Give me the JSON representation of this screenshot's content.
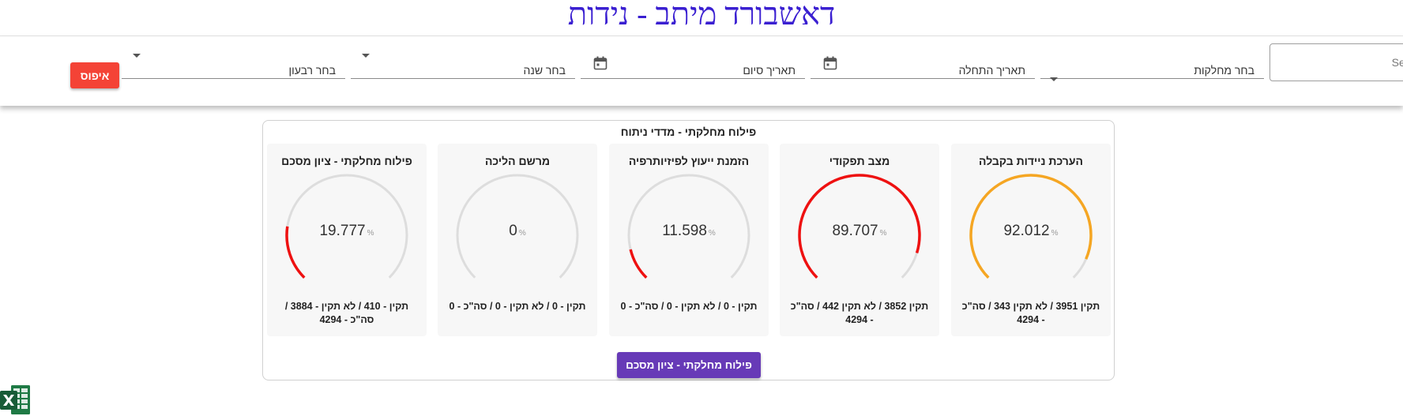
{
  "page": {
    "title": "דאשבורד מיתב - נידות"
  },
  "filters": {
    "search_placeholder": "Search",
    "departments_label": "בחר מחלקות",
    "start_date_label": "תאריך התחלה",
    "end_date_label": "תאריך סיום",
    "year_label": "בחר שנה",
    "quarter_label": "בחר רבעון",
    "reset_label": "איפוס"
  },
  "panel": {
    "title": "פילוח מחלקתי - מדדי ניתוח",
    "button_label": "פילוח מחלקתי - ציון מסכם",
    "percent_symbol": "%",
    "cards": [
      {
        "title": "הערכת ניידות בקבלה",
        "value": "92.012",
        "level": 0.92012,
        "color": "#f5a623",
        "footer": "תקין 3951 / לא תקין 343 / סה\"כ - 4294"
      },
      {
        "title": "מצב תפקודי",
        "value": "89.707",
        "level": 0.89707,
        "color": "#ee1111",
        "footer": "תקין 3852 / לא תקין 442 / סה\"כ - 4294"
      },
      {
        "title": "הזמנת ייעוץ לפיזיותרפיה",
        "value": "11.598",
        "level": 0.11598,
        "color": "#ee1111",
        "footer": "תקין - 0 / לא תקין - 0 / סה\"כ - 0"
      },
      {
        "title": "מרשם הליכה",
        "value": "0",
        "level": 0,
        "color": "#ee1111",
        "footer": "תקין - 0 / לא תקין - 0 / סה\"כ - 0"
      },
      {
        "title": "פילוח מחלקתי - ציון מסכם",
        "value": "19.777",
        "level": 0.19777,
        "color": "#ee1111",
        "footer": "תקין - 410 / לא תקין - 3884 / סה\"כ - 4294"
      }
    ]
  },
  "icons": {
    "export": "excel-icon",
    "calendar": "calendar-icon",
    "dropdown": "chevron-down-icon"
  }
}
